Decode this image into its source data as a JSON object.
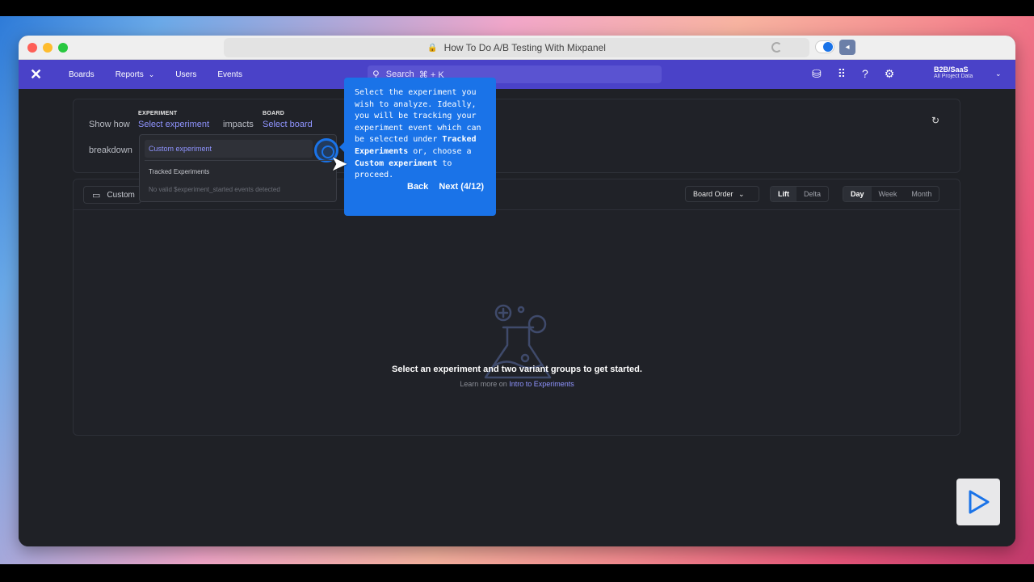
{
  "browser": {
    "url_title": "How To Do A/B Testing With Mixpanel"
  },
  "nav": {
    "items": [
      {
        "label": "Boards"
      },
      {
        "label": "Reports",
        "has_chevron": true
      },
      {
        "label": "Users"
      },
      {
        "label": "Events"
      }
    ],
    "search_text": "Search",
    "search_shortcut": "⌘ + K",
    "project_name": "B2B/SaaS",
    "project_sub": "All Project Data"
  },
  "query": {
    "show_how": "Show how",
    "experiment_label": "EXPERIMENT",
    "experiment_value": "Select experiment",
    "impacts": "impacts",
    "board_label": "BOARD",
    "board_value": "Select board",
    "breakdown": "breakdown"
  },
  "dropdown": {
    "option": "Custom experiment",
    "section": "Tracked Experiments",
    "empty": "No valid $experiment_started events detected"
  },
  "tooltip": {
    "line1": "Select the experiment you wish to analyze. Ideally, you will be tracking your experiment event which can be selected under ",
    "bold1": "Tracked Experiments",
    "line2": " or, choose a ",
    "bold2": "Custom experiment",
    "line3": " to proceed.",
    "back": "Back",
    "next": "Next (4/12)"
  },
  "controls": {
    "custom": "Custom",
    "board_order": "Board Order",
    "lift": "Lift",
    "delta": "Delta",
    "day": "Day",
    "week": "Week",
    "month": "Month"
  },
  "empty_state": {
    "title": "Select an experiment and two variant groups to get started.",
    "learn_prefix": "Learn more on ",
    "learn_link": "Intro to Experiments"
  },
  "colors": {
    "nav_bg": "#4a42c8",
    "tooltip_bg": "#1a73e8",
    "link": "#8f94ff"
  }
}
